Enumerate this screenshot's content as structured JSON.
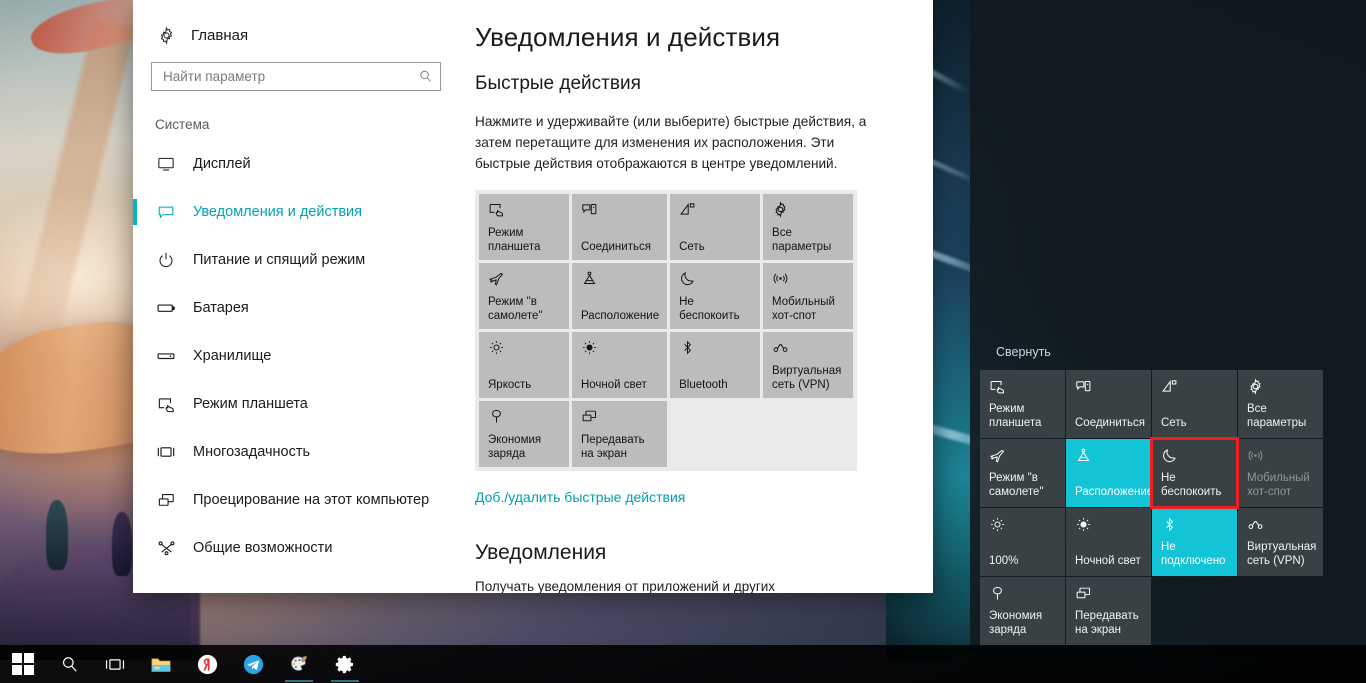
{
  "window": {
    "title": "Уведомления и действия"
  },
  "sidebar": {
    "home_label": "Главная",
    "home_icon": "gear-icon",
    "search": {
      "placeholder": "Найти параметр",
      "value": "",
      "icon": "search-icon"
    },
    "group_title": "Система",
    "items": [
      {
        "label": "Дисплей",
        "icon": "monitor-icon",
        "active": false
      },
      {
        "label": "Уведомления и действия",
        "icon": "chat-bubble-icon",
        "active": true
      },
      {
        "label": "Питание и спящий режим",
        "icon": "power-icon",
        "active": false
      },
      {
        "label": "Батарея",
        "icon": "battery-icon",
        "active": false
      },
      {
        "label": "Хранилище",
        "icon": "storage-icon",
        "active": false
      },
      {
        "label": "Режим планшета",
        "icon": "tablet-mode-icon",
        "active": false
      },
      {
        "label": "Многозадачность",
        "icon": "multitasking-icon",
        "active": false
      },
      {
        "label": "Проецирование на этот компьютер",
        "icon": "project-icon",
        "active": false
      },
      {
        "label": "Общие возможности",
        "icon": "shared-experiences-icon",
        "active": false
      }
    ]
  },
  "main": {
    "page_title": "Уведомления и действия",
    "quick_actions_heading": "Быстрые действия",
    "description": "Нажмите и удерживайте (или выберите) быстрые действия, а затем перетащите для изменения их расположения. Эти быстрые действия отображаются в центре уведомлений.",
    "tiles": [
      {
        "label": "Режим планшета",
        "icon": "tablet-mode-icon"
      },
      {
        "label": "Соединиться",
        "icon": "connect-icon"
      },
      {
        "label": "Сеть",
        "icon": "network-icon"
      },
      {
        "label": "Все параметры",
        "icon": "gear-icon"
      },
      {
        "label": "Режим \"в самолете\"",
        "icon": "airplane-icon"
      },
      {
        "label": "Расположение",
        "icon": "location-icon"
      },
      {
        "label": "Не беспокоить",
        "icon": "moon-icon"
      },
      {
        "label": "Мобильный хот-спот",
        "icon": "hotspot-icon"
      },
      {
        "label": "Яркость",
        "icon": "brightness-icon"
      },
      {
        "label": "Ночной свет",
        "icon": "night-light-icon"
      },
      {
        "label": "Bluetooth",
        "icon": "bluetooth-icon"
      },
      {
        "label": "Виртуальная сеть (VPN)",
        "icon": "vpn-icon"
      },
      {
        "label": "Экономия заряда",
        "icon": "battery-saver-icon"
      },
      {
        "label": "Передавать на экран",
        "icon": "project-icon"
      }
    ],
    "add_remove_link": "Доб./удалить быстрые действия",
    "notifications_heading": "Уведомления",
    "notifications_cut_text": "Получать уведомления от приложений и других"
  },
  "action_center": {
    "collapse_label": "Свернуть",
    "tiles": [
      {
        "label": "Режим планшета",
        "icon": "tablet-mode-icon",
        "state": "off"
      },
      {
        "label": "Соединиться",
        "icon": "connect-icon",
        "state": "off"
      },
      {
        "label": "Сеть",
        "icon": "network-icon",
        "state": "off"
      },
      {
        "label": "Все параметры",
        "icon": "gear-icon",
        "state": "off"
      },
      {
        "label": "Режим \"в самолете\"",
        "icon": "airplane-icon",
        "state": "off"
      },
      {
        "label": "Расположение",
        "icon": "location-icon",
        "state": "on"
      },
      {
        "label": "Не беспокоить",
        "icon": "moon-icon",
        "state": "off",
        "highlighted": true
      },
      {
        "label": "Мобильный хот-спот",
        "icon": "hotspot-icon",
        "state": "dim"
      },
      {
        "label": "100%",
        "icon": "brightness-icon",
        "state": "off"
      },
      {
        "label": "Ночной свет",
        "icon": "night-light-icon",
        "state": "off"
      },
      {
        "label": "Не подключено",
        "icon": "bluetooth-icon",
        "state": "on"
      },
      {
        "label": "Виртуальная сеть (VPN)",
        "icon": "vpn-icon",
        "state": "off"
      },
      {
        "label": "Экономия заряда",
        "icon": "battery-saver-icon",
        "state": "off"
      },
      {
        "label": "Передавать на экран",
        "icon": "project-icon",
        "state": "off"
      }
    ],
    "highlight_color": "#f01f1f",
    "accent_color": "#13c3d6"
  },
  "taskbar": {
    "buttons": [
      {
        "name": "start-button",
        "icon": "windows-logo-icon",
        "running": false
      },
      {
        "name": "search-button",
        "icon": "search-icon",
        "running": false
      },
      {
        "name": "task-view-button",
        "icon": "task-view-icon",
        "running": false
      },
      {
        "name": "file-explorer-button",
        "icon": "folder-icon",
        "running": false
      },
      {
        "name": "yandex-browser-button",
        "icon": "yandex-icon",
        "running": false
      },
      {
        "name": "telegram-button",
        "icon": "telegram-icon",
        "running": false
      },
      {
        "name": "paint-button",
        "icon": "paint-palette-icon",
        "running": true
      },
      {
        "name": "settings-button",
        "icon": "gear-icon",
        "running": true
      }
    ]
  },
  "theme": {
    "accent": "#00b7c3",
    "link": "#00a0ae",
    "tile_light_bg": "#bcbcbc",
    "tile_dark_bg": "#3a4145"
  }
}
